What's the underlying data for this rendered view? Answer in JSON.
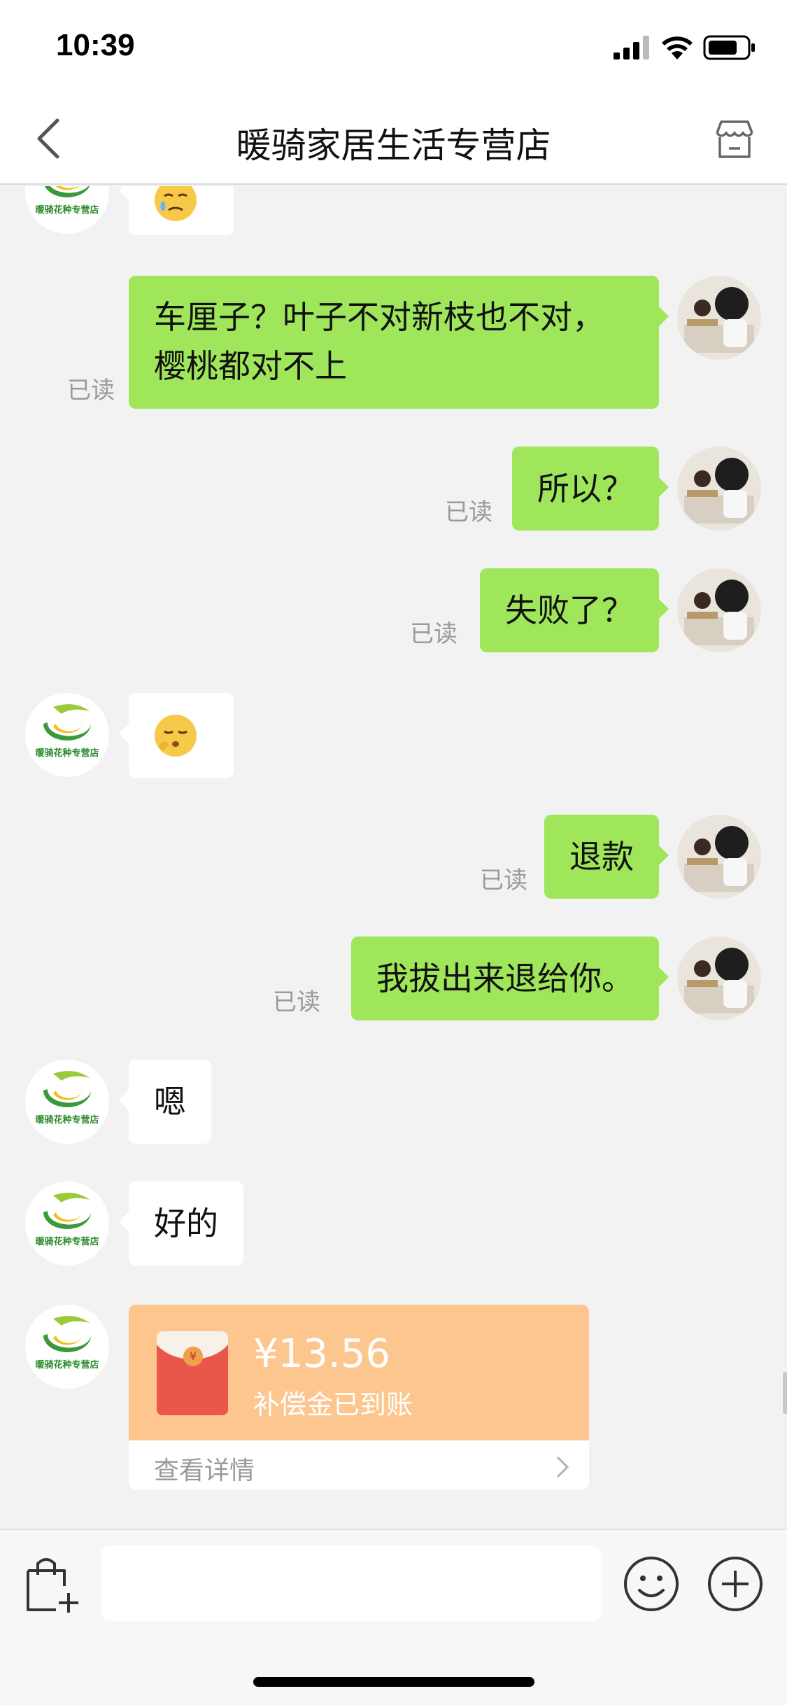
{
  "status_bar": {
    "time": "10:39"
  },
  "header": {
    "title": "暖骑家居生活专营店"
  },
  "messages": [
    {
      "from": "shop",
      "kind": "emoji",
      "emoji": "crying-face-icon"
    },
    {
      "from": "me",
      "text_line1": "车厘子？叶子不对新枝也不对，",
      "text_line2": "樱桃都对不上",
      "read": "已读"
    },
    {
      "from": "me",
      "text": "所以？",
      "read": "已读"
    },
    {
      "from": "me",
      "text": "失败了？",
      "read": "已读"
    },
    {
      "from": "shop",
      "kind": "emoji",
      "emoji": "shushing-face-icon"
    },
    {
      "from": "me",
      "text": "退款",
      "read": "已读"
    },
    {
      "from": "me",
      "text": "我拔出来退给你。",
      "read": "已读"
    },
    {
      "from": "shop",
      "text": "嗯"
    },
    {
      "from": "shop",
      "text": "好的"
    }
  ],
  "red_packet": {
    "amount": "¥13.56",
    "subtitle": "补偿金已到账",
    "detail_link": "查看详情",
    "coin_glyph": "¥"
  },
  "shop_logo_text": "暖骑花种专营店",
  "input": {
    "placeholder": ""
  },
  "colors": {
    "out_bubble": "#9fe65a",
    "in_bubble": "#ffffff",
    "background": "#f2f2f2",
    "red_packet_bg": "#fdc68f",
    "envelope_red": "#e8574a"
  }
}
